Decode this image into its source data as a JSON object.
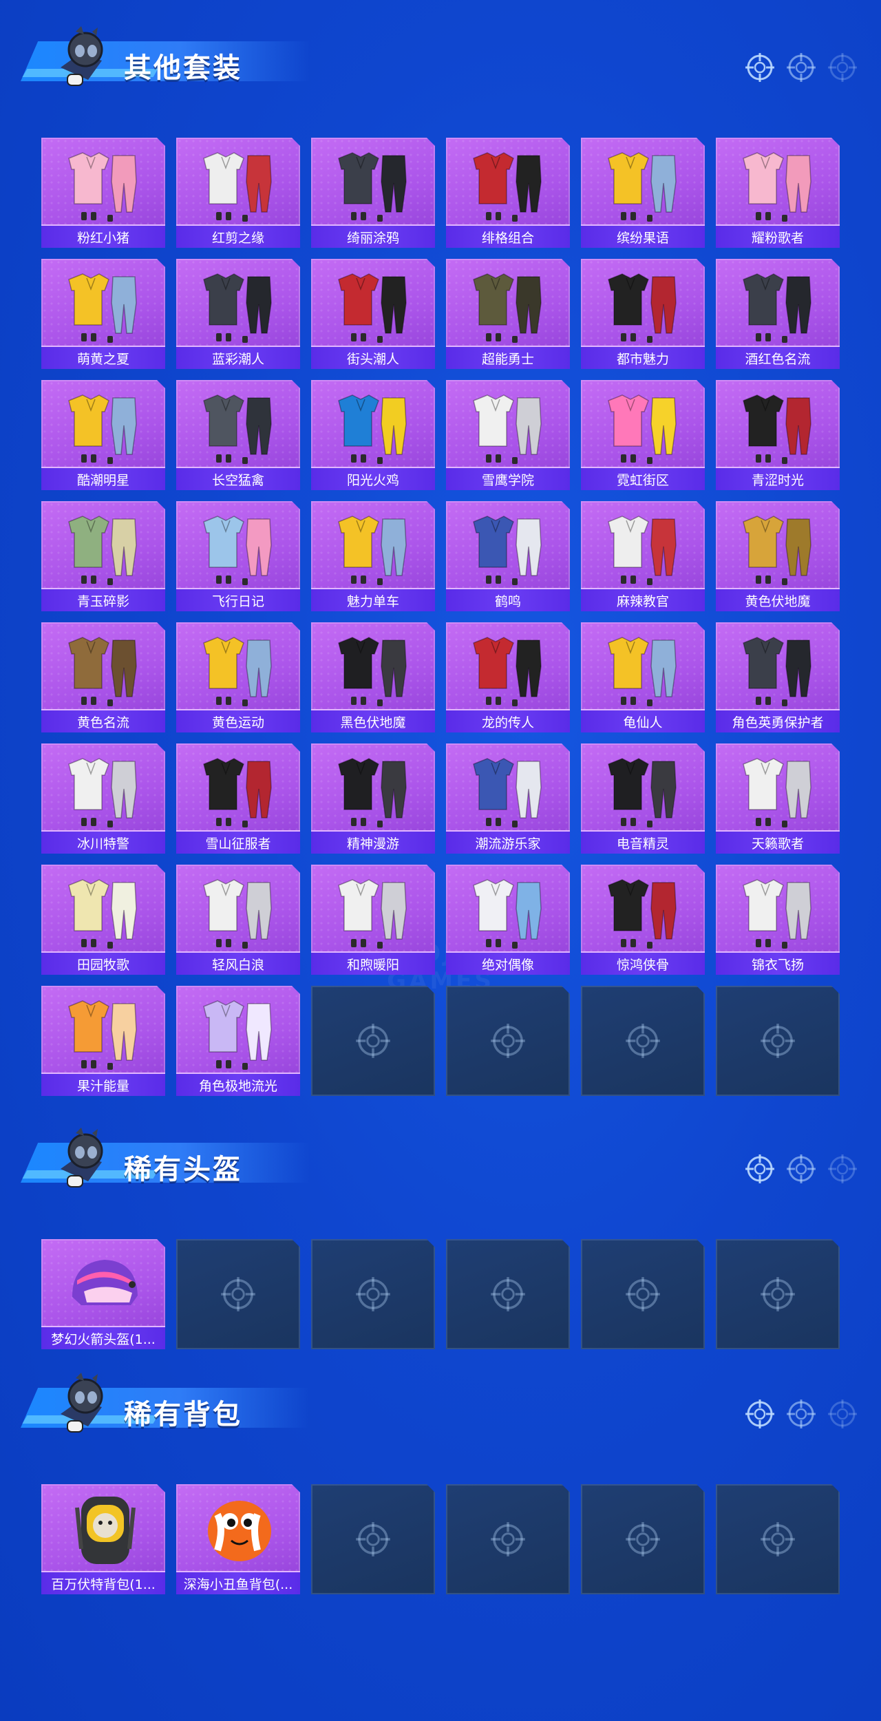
{
  "watermark": "QMMOJ.COM GAMES",
  "colors": {
    "background": "#0f46cf",
    "card_fill": "#b05cee",
    "label_bar": "#5f32ee",
    "empty_card": "#1d3968"
  },
  "icons": {
    "mascot": "masked-soldier-mascot-icon",
    "target": "crosshair-target-icon"
  },
  "sections": [
    {
      "title": "其他套装",
      "items": [
        {
          "label": "粉红小猪",
          "art": "pink"
        },
        {
          "label": "红剪之缘",
          "art": "white-red"
        },
        {
          "label": "绮丽涂鸦",
          "art": "dark"
        },
        {
          "label": "绯格组合",
          "art": "red"
        },
        {
          "label": "缤纷果语",
          "art": "yellow"
        },
        {
          "label": "耀粉歌者",
          "art": "pink"
        },
        {
          "label": "萌黄之夏",
          "art": "yellow"
        },
        {
          "label": "蓝彩潮人",
          "art": "dark"
        },
        {
          "label": "街头潮人",
          "art": "red"
        },
        {
          "label": "超能勇士",
          "art": "olive"
        },
        {
          "label": "都市魅力",
          "art": "black-red"
        },
        {
          "label": "酒红色名流",
          "art": "dark"
        },
        {
          "label": "酷潮明星",
          "art": "yellow"
        },
        {
          "label": "长空猛禽",
          "art": "gray"
        },
        {
          "label": "阳光火鸡",
          "art": "blue-yellow"
        },
        {
          "label": "雪鹰学院",
          "art": "white"
        },
        {
          "label": "霓虹街区",
          "art": "pink-yellow"
        },
        {
          "label": "青涩时光",
          "art": "black-red"
        },
        {
          "label": "青玉碎影",
          "art": "green"
        },
        {
          "label": "飞行日记",
          "art": "pink-blue"
        },
        {
          "label": "魅力单车",
          "art": "yellow"
        },
        {
          "label": "鹤鸣",
          "art": "blue"
        },
        {
          "label": "麻辣教官",
          "art": "white-red"
        },
        {
          "label": "黄色伏地魔",
          "art": "mustard"
        },
        {
          "label": "黄色名流",
          "art": "brown"
        },
        {
          "label": "黄色运动",
          "art": "yellow"
        },
        {
          "label": "黑色伏地魔",
          "art": "black"
        },
        {
          "label": "龙的传人",
          "art": "red"
        },
        {
          "label": "龟仙人",
          "art": "yellow"
        },
        {
          "label": "角色英勇保护者",
          "art": "dark"
        },
        {
          "label": "冰川特警",
          "art": "white"
        },
        {
          "label": "雪山征服者",
          "art": "black-red"
        },
        {
          "label": "精神漫游",
          "art": "black"
        },
        {
          "label": "潮流游乐家",
          "art": "blue"
        },
        {
          "label": "电音精灵",
          "art": "black"
        },
        {
          "label": "天籁歌者",
          "art": "white"
        },
        {
          "label": "田园牧歌",
          "art": "cream"
        },
        {
          "label": "轻风白浪",
          "art": "white"
        },
        {
          "label": "和煦暖阳",
          "art": "white"
        },
        {
          "label": "绝对偶像",
          "art": "white-blue"
        },
        {
          "label": "惊鸿侠骨",
          "art": "black-red"
        },
        {
          "label": "锦衣飞扬",
          "art": "white"
        },
        {
          "label": "果汁能量",
          "art": "orange"
        },
        {
          "label": "角色极地流光",
          "art": "lavender"
        }
      ],
      "empty_slots": 4
    },
    {
      "title": "稀有头盔",
      "items": [
        {
          "label": "梦幻火箭头盔(1...",
          "art": "helmet"
        }
      ],
      "empty_slots": 5
    },
    {
      "title": "稀有背包",
      "items": [
        {
          "label": "百万伏特背包(1...",
          "art": "backpack-yellow"
        },
        {
          "label": "深海小丑鱼背包(...",
          "art": "backpack-orange"
        }
      ],
      "empty_slots": 4
    }
  ]
}
